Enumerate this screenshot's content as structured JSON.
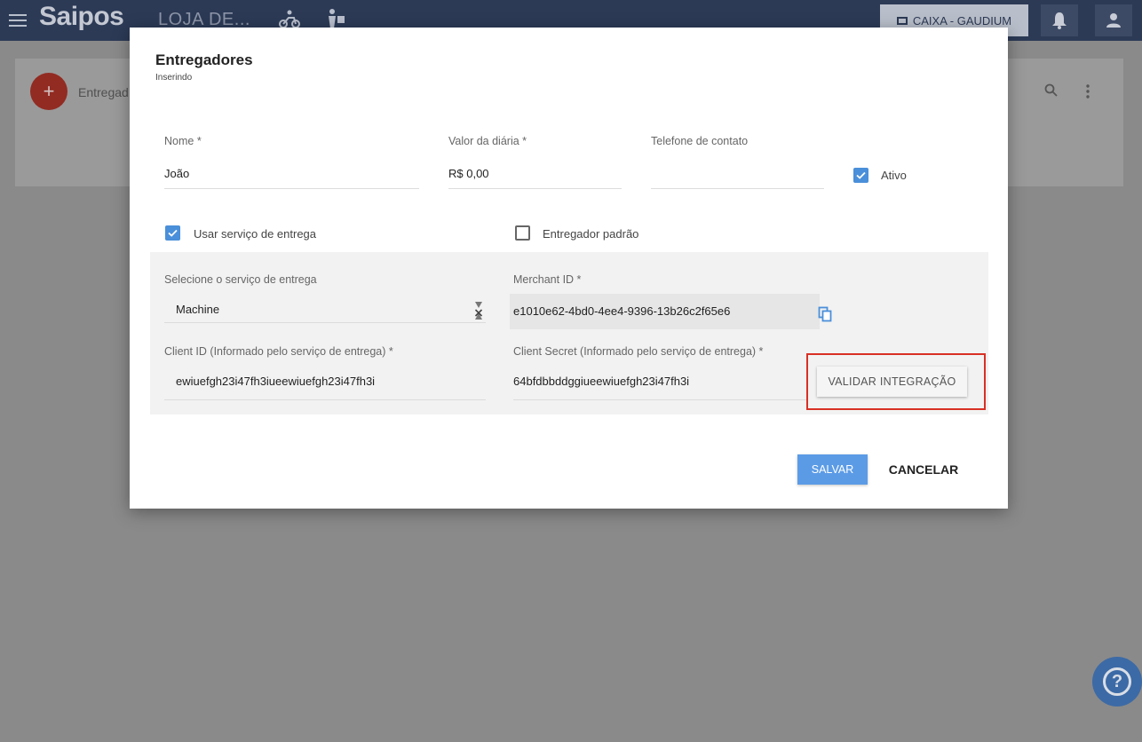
{
  "topbar": {
    "logo": "Saipos",
    "store_name": "LOJA DE...",
    "cashier_label": "CAIXA - GAUDIUM"
  },
  "background_page": {
    "title": "Entregad"
  },
  "modal": {
    "title": "Entregadores",
    "subtitle": "Inserindo",
    "fields": {
      "nome": {
        "label": "Nome *",
        "value": "João"
      },
      "valor_diaria": {
        "label": "Valor da diária *",
        "value": "R$ 0,00"
      },
      "telefone": {
        "label": "Telefone de contato",
        "value": ""
      }
    },
    "checkboxes": {
      "ativo": {
        "label": "Ativo",
        "checked": true
      },
      "usar_servico": {
        "label": "Usar serviço de entrega",
        "checked": true
      },
      "entregador_padrao": {
        "label": "Entregador padrão",
        "checked": false
      }
    },
    "service": {
      "select_label": "Selecione o serviço de entrega",
      "select_value": "Machine",
      "merchant_label": "Merchant ID *",
      "merchant_value": "e1010e62-4bd0-4ee4-9396-13b26c2f65e6",
      "client_id_label": "Client ID (Informado pelo serviço de entrega) *",
      "client_id_value": "ewiuefgh23i47fh3iueewiuefgh23i47fh3i",
      "client_secret_label": "Client Secret (Informado pelo serviço de entrega) *",
      "client_secret_value": "64bfdbbddggiueewiuefgh23i47fh3i",
      "validate_label": "VALIDAR INTEGRAÇÃO"
    },
    "actions": {
      "save_label": "SALVAR",
      "cancel_label": "CANCELAR"
    }
  },
  "colors": {
    "accent": "#4a8fd9",
    "save": "#5b9be6",
    "highlight": "#d93025",
    "topbar": "#2c3a56"
  },
  "icons": {
    "menu": "hamburger-icon",
    "courier": "motorcycle-icon",
    "delivery": "person-delivery-icon",
    "register": "cash-register-icon",
    "notifications": "bell-icon",
    "user": "user-icon",
    "copy": "copy-icon",
    "clear": "clear-icon",
    "help": "help-icon"
  }
}
